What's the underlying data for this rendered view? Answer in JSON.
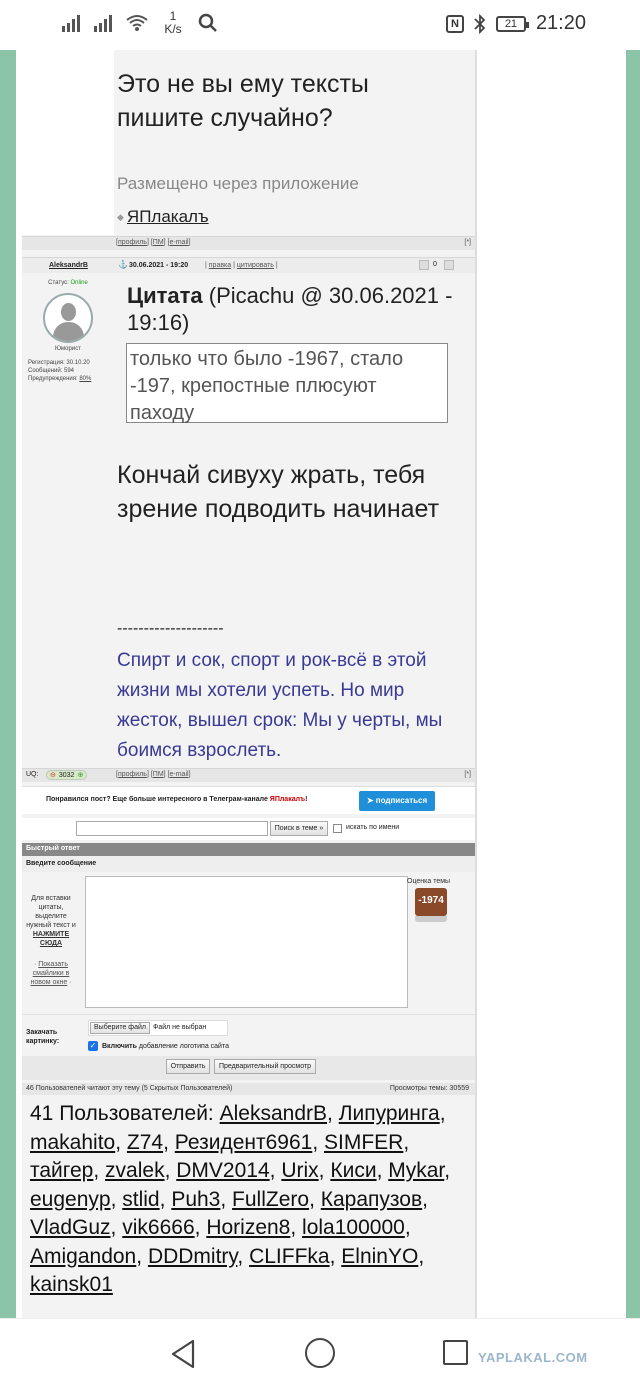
{
  "status_bar": {
    "speed_value": "1",
    "speed_unit": "K/s",
    "battery": "21",
    "time": "21:20",
    "nfc": "N"
  },
  "post1": {
    "text": "Это не вы ему тексты пишите случайно?",
    "posted_via": "Размещено через приложение",
    "app_link": "ЯПлакалъ",
    "links": [
      "профиль",
      "ПМ",
      "e-mail"
    ],
    "quote_mark": "[*]"
  },
  "post2": {
    "author": "AleksandrB",
    "status_label": "Статус:",
    "status_value": "Online",
    "rank": "Юморист",
    "reg_label": "Регистрация: 30.10.20",
    "posts_label": "Сообщений: 594",
    "warnings_label": "Предупреждения:",
    "warnings_value": "80%",
    "anchor": "⚓",
    "datetime": "30.06.2021 - 19:20",
    "edit": "правка",
    "cite": "цитировать",
    "votes": "0",
    "quote_title": "Цитата",
    "quote_meta": "(Picachu @ 30.06.2021 - 19:16)",
    "quote_text": "только что было -1967, стало -197, крепостные плюсуют паходу",
    "text": "Кончай сивуху жрать, тебя зрение подводить начинает",
    "separator": "--------------------",
    "signature": "Спирт и сок, спорт и рок-всё в этой жизни мы хотели успеть. Но мир жесток, вышел срок: Мы у черты, мы боимся взрослеть.",
    "uq_label": "UQ:",
    "uq_value": "3032",
    "links": [
      "профиль",
      "ПМ",
      "e-mail"
    ],
    "quote_mark": "[*]"
  },
  "promo": {
    "text_before": "Понравился пост? Еще больше интересного в Телеграм-канале ",
    "brand": "ЯПлакалъ",
    "text_after": "!",
    "button": "подписаться"
  },
  "search": {
    "button": "Поиск в теме »",
    "checkbox_label": "искать по имени"
  },
  "reply": {
    "header": "Быстрый ответ",
    "sub": "Введите сообщение",
    "hint1": "Для вставки цитаты, выделите нужный текст и",
    "hint_link": "НАЖМИТЕ СЮДА",
    "smileys_link": "Показать смайлики в новом окне",
    "rating_label": "Оценка темы",
    "rating_value": "-1974",
    "upload_label": "Закачать картинку:",
    "file_button": "Выберите файл",
    "file_none": "Файл не выбран",
    "logo_check_bold": "Включить",
    "logo_check_rest": "добавление логотипа сайта",
    "send": "Отправить",
    "preview": "Предварительный просмотр"
  },
  "readers": {
    "summary": "46 Пользователей читают эту тему (5 Скрытых Пользователей)",
    "views": "Просмотры темы: 30559",
    "count_label": "41 Пользователей:",
    "names": [
      "AleksandrB",
      "Липуринга",
      "makahito",
      "Z74",
      "Резидент6961",
      "SIMFER",
      "тайгер",
      "zvalek",
      "DMV2014",
      "Urix",
      "Киси",
      "Mykar",
      "eugenyp",
      "stlid",
      "Puh3",
      "FullZero",
      "Карапузов",
      "VladGuz",
      "vik6666",
      "Horizen8",
      "lola100000",
      "Amigandon",
      "DDDmitry",
      "CLIFFka",
      "ElninYO",
      "kainsk01"
    ]
  },
  "navbar": {
    "brand": "YAPLAKAL.COM"
  }
}
